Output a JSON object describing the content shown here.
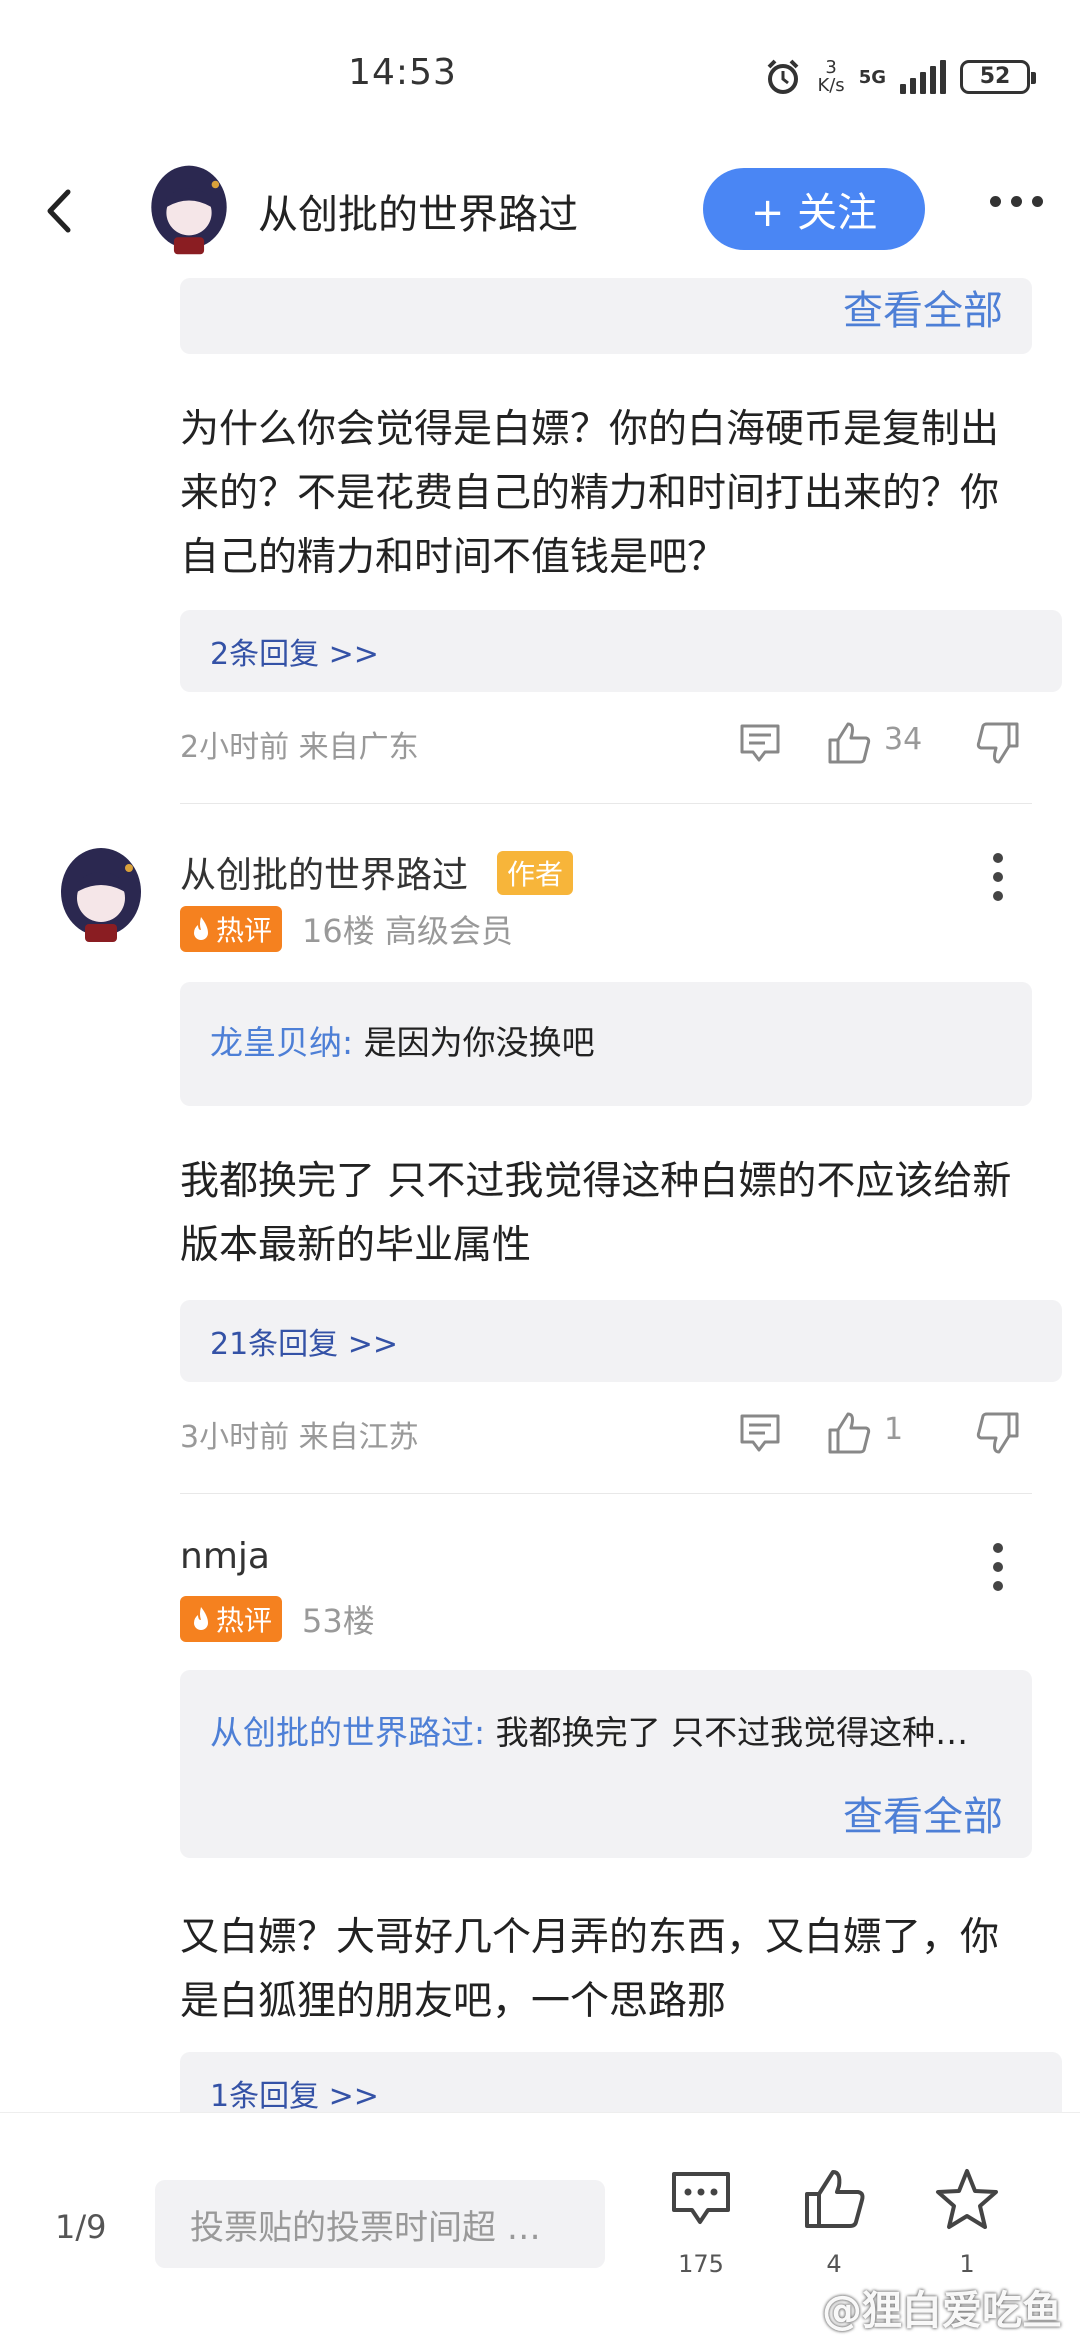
{
  "status_bar": {
    "time": "14:53",
    "speed_num": "3",
    "speed_unit": "K/s",
    "network": "5G",
    "battery": "52"
  },
  "header": {
    "title": "从创批的世界路过",
    "follow_label": "+ 关注"
  },
  "top_fragment": {
    "see_all": "查看全部"
  },
  "comment1": {
    "text": "为什么你会觉得是白嫖？你的白海硬币是复制出来的？不是花费自己的精力和时间打出来的？你自己的精力和时间不值钱是吧？",
    "replies": "2条回复 >>",
    "meta": "2小时前 来自广东",
    "likes": "34"
  },
  "comment2": {
    "user": "从创批的世界路过",
    "badge": "作者",
    "hot": "热评",
    "floor": "16楼 高级会员",
    "quote_user": "龙皇贝纳:",
    "quote_text": "是因为你没换吧",
    "text": "我都换完了 只不过我觉得这种白嫖的不应该给新版本最新的毕业属性",
    "replies": "21条回复 >>",
    "meta": "3小时前 来自江苏",
    "likes": "1"
  },
  "comment3": {
    "user": "nmja",
    "hot": "热评",
    "floor": "53楼",
    "quote_user": "从创批的世界路过:",
    "quote_text": "我都换完了 只不过我觉得这种…",
    "see_all": "查看全部",
    "text": "又白嫖？大哥好几个月弄的东西，又白嫖了，你是白狐狸的朋友吧，一个思路那",
    "replies": "1条回复 >>"
  },
  "bottom_bar": {
    "page": "1/9",
    "input_placeholder": "投票贴的投票时间超 …",
    "comments": "175",
    "likes": "4",
    "favorites": "1",
    "watermark": "@狸白爱吃鱼"
  },
  "colors": {
    "accent": "#4a86f4",
    "link": "#4d7fd6",
    "reply_link": "#3452a6",
    "hot_badge": "#f5811f",
    "author_badge": "#f7b53a"
  }
}
